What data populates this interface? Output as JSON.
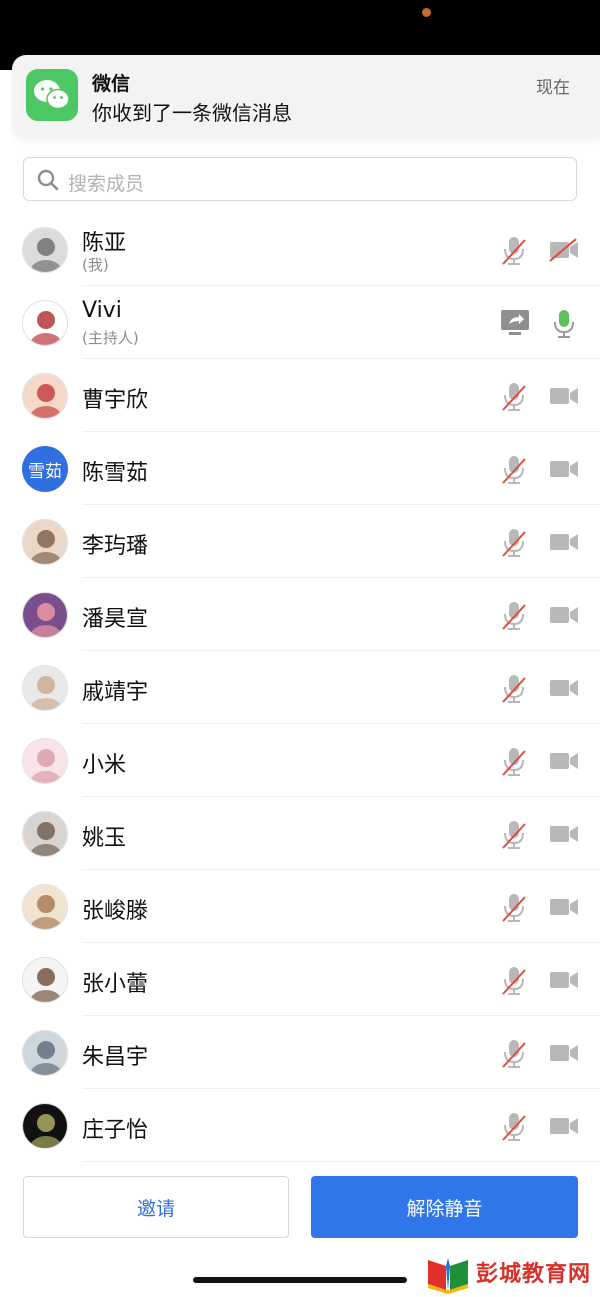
{
  "notification": {
    "app": "微信",
    "message": "你收到了一条微信消息",
    "time": "现在",
    "icon": "wechat-icon"
  },
  "search": {
    "placeholder": "搜索成员"
  },
  "members": [
    {
      "name": "陈亚",
      "sub": "(我)",
      "mic": "muted",
      "camera": "off"
    },
    {
      "name": "Vivi",
      "sub": "(主持人)",
      "mic": "active",
      "sharing": true
    },
    {
      "name": "曹宇欣",
      "mic": "muted",
      "camera": "on"
    },
    {
      "name": "陈雪茹",
      "avatar_text": "雪茹",
      "mic": "muted",
      "camera": "on"
    },
    {
      "name": "李玙璠",
      "mic": "muted",
      "camera": "on"
    },
    {
      "name": "潘昊宣",
      "mic": "muted",
      "camera": "on"
    },
    {
      "name": "戚靖宇",
      "mic": "muted",
      "camera": "on"
    },
    {
      "name": "小米",
      "mic": "muted",
      "camera": "on"
    },
    {
      "name": "姚玉",
      "mic": "muted",
      "camera": "on"
    },
    {
      "name": "张峻滕",
      "mic": "muted",
      "camera": "on"
    },
    {
      "name": "张小蕾",
      "mic": "muted",
      "camera": "on"
    },
    {
      "name": "朱昌宇",
      "mic": "muted",
      "camera": "on"
    },
    {
      "name": "庄子怡",
      "mic": "muted",
      "camera": "on"
    }
  ],
  "buttons": {
    "invite": "邀请",
    "unmute": "解除静音"
  },
  "watermark": {
    "text": "彭城教育网"
  },
  "colors": {
    "accent": "#2f76ea",
    "muted_slash": "#e04b3c",
    "mic_active": "#5cc15a"
  }
}
